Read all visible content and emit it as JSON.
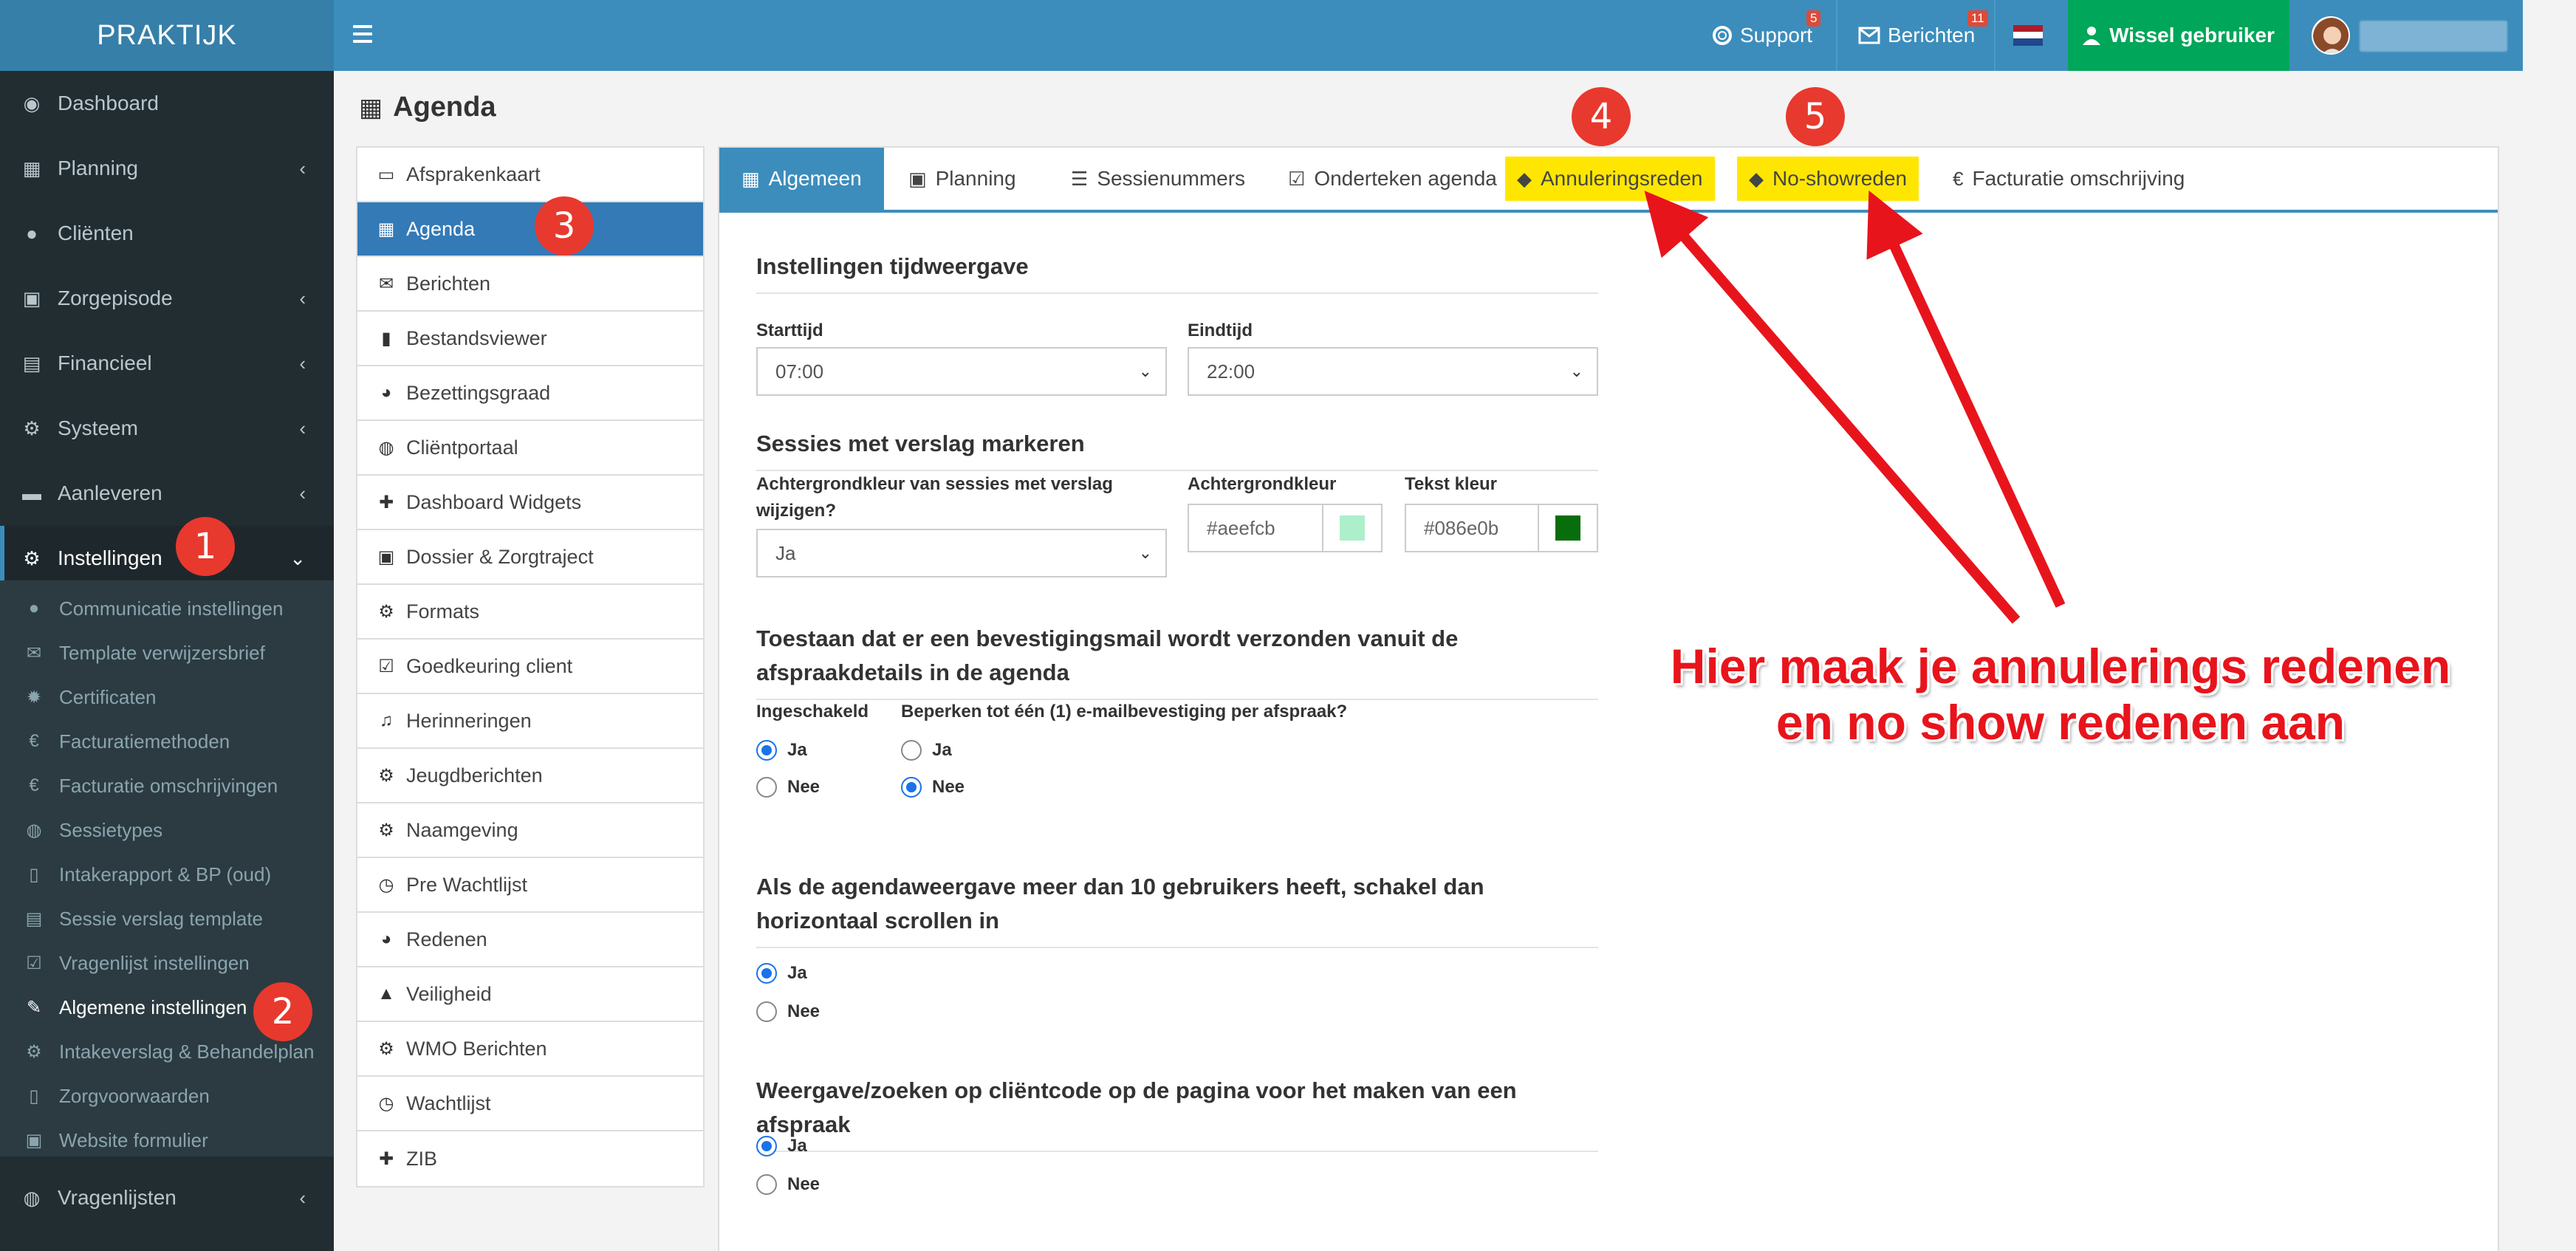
{
  "app": {
    "logo": "PRAKTIJK"
  },
  "topbar": {
    "support_label": "Support",
    "support_badge": "5",
    "messages_label": "Berichten",
    "messages_badge": "11",
    "switch_user_label": "Wissel gebruiker"
  },
  "sidebar": {
    "items": [
      {
        "label": "Dashboard",
        "icon": "dashboard-icon"
      },
      {
        "label": "Planning",
        "icon": "calendar-icon"
      },
      {
        "label": "Cliënten",
        "icon": "user-icon"
      },
      {
        "label": "Zorgepisode",
        "icon": "medkit-icon"
      },
      {
        "label": "Financieel",
        "icon": "book-icon"
      },
      {
        "label": "Systeem",
        "icon": "cogs-icon"
      },
      {
        "label": "Aanleveren",
        "icon": "truck-icon"
      },
      {
        "label": "Instellingen",
        "icon": "gear-icon"
      },
      {
        "label": "Vragenlijsten",
        "icon": "globe-icon"
      }
    ],
    "submenu": [
      {
        "label": "Communicatie instellingen"
      },
      {
        "label": "Template verwijzersbrief"
      },
      {
        "label": "Certificaten"
      },
      {
        "label": "Facturatiemethoden"
      },
      {
        "label": "Facturatie omschrijvingen"
      },
      {
        "label": "Sessietypes"
      },
      {
        "label": "Intakerapport & BP (oud)"
      },
      {
        "label": "Sessie verslag template"
      },
      {
        "label": "Vragenlijst instellingen"
      },
      {
        "label": "Algemene instellingen"
      },
      {
        "label": "Intakeverslag & Behandelplan"
      },
      {
        "label": "Zorgvoorwaarden"
      },
      {
        "label": "Website formulier"
      }
    ]
  },
  "page": {
    "title": "Agenda"
  },
  "settings_list": [
    {
      "label": "Afsprakenkaart"
    },
    {
      "label": "Agenda"
    },
    {
      "label": "Berichten"
    },
    {
      "label": "Bestandsviewer"
    },
    {
      "label": "Bezettingsgraad"
    },
    {
      "label": "Cliëntportaal"
    },
    {
      "label": "Dashboard Widgets"
    },
    {
      "label": "Dossier & Zorgtraject"
    },
    {
      "label": "Formats"
    },
    {
      "label": "Goedkeuring client"
    },
    {
      "label": "Herinneringen"
    },
    {
      "label": "Jeugdberichten"
    },
    {
      "label": "Naamgeving"
    },
    {
      "label": "Pre Wachtlijst"
    },
    {
      "label": "Redenen"
    },
    {
      "label": "Veiligheid"
    },
    {
      "label": "WMO Berichten"
    },
    {
      "label": "Wachtlijst"
    },
    {
      "label": "ZIB"
    }
  ],
  "tabs": [
    {
      "label": "Algemeen"
    },
    {
      "label": "Planning"
    },
    {
      "label": "Sessienummers"
    },
    {
      "label": "Onderteken agenda"
    },
    {
      "label": "Annuleringsreden"
    },
    {
      "label": "No-showreden"
    },
    {
      "label": "Facturatie omschrijving"
    }
  ],
  "form": {
    "section1_title": "Instellingen tijdweergave",
    "start_label": "Starttijd",
    "start_value": "07:00",
    "end_label": "Eindtijd",
    "end_value": "22:00",
    "section2_title": "Sessies met verslag markeren",
    "change_bg_label": "Achtergrondkleur van sessies met verslag wijzigen?",
    "change_bg_value": "Ja",
    "bg_color_label": "Achtergrondkleur",
    "bg_color_value": "#aeefcb",
    "text_color_label": "Tekst kleur",
    "text_color_value": "#086e0b",
    "section3_title": "Toestaan dat er een bevestigingsmail wordt verzonden vanuit de afspraakdetails in de agenda",
    "enabled_label": "Ingeschakeld",
    "limit_label": "Beperken tot één (1) e-mailbevestiging per afspraak?",
    "yes": "Ja",
    "no": "Nee",
    "section4_title": "Als de agendaweergave meer dan 10 gebruikers heeft, schakel dan horizontaal scrollen in",
    "section5_title": "Weergave/zoeken op cliëntcode op de pagina voor het maken van een afspraak"
  },
  "annotations": {
    "markers": [
      "1",
      "2",
      "3",
      "4",
      "5"
    ],
    "text_line1": "Hier maak je annulerings redenen",
    "text_line2": "en no show redenen aan"
  },
  "colors": {
    "primary": "#3c8dbc",
    "sidebar_bg": "#222d32",
    "success": "#00a65a",
    "highlight": "#ffe600",
    "annotation_red": "#e8141c"
  }
}
